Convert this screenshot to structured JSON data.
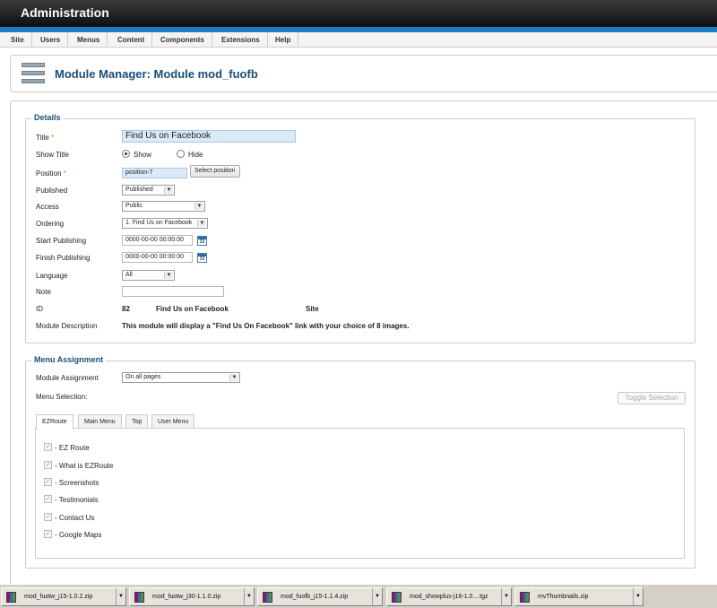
{
  "header": {
    "title": "Administration"
  },
  "menu": [
    "Site",
    "Users",
    "Menus",
    "Content",
    "Components",
    "Extensions",
    "Help"
  ],
  "page_title": "Module Manager: Module mod_fuofb",
  "details": {
    "legend": "Details",
    "title_label": "Title",
    "title_value": "Find Us on Facebook",
    "show_title_label": "Show Title",
    "show_option": "Show",
    "hide_option": "Hide",
    "position_label": "Position",
    "position_value": "position-7",
    "select_position_button": "Select position",
    "published_label": "Published",
    "published_value": "Published",
    "access_label": "Access",
    "access_value": "Public",
    "ordering_label": "Ordering",
    "ordering_value": "1. Find Us on Facebook",
    "start_publishing_label": "Start Publishing",
    "start_publishing_value": "0000-00-00 00:00:00",
    "finish_publishing_label": "Finish Publishing",
    "finish_publishing_value": "0000-00-00 00:00:00",
    "calendar_day": "33",
    "language_label": "Language",
    "language_value": "All",
    "note_label": "Note",
    "note_value": "",
    "id_label": "ID",
    "id_value": "82",
    "id_module_name": "Find Us on Facebook",
    "id_client": "Site",
    "description_label": "Module Description",
    "description_value": "This module will display a \"Find Us On Facebook\" link with your choice of 8 images."
  },
  "menu_assignment": {
    "legend": "Menu Assignment",
    "module_assignment_label": "Module Assignment",
    "module_assignment_value": "On all pages",
    "menu_selection_label": "Menu Selection:",
    "toggle_button": "Toggle Selection",
    "tabs": [
      "EZRoute",
      "Main Menu",
      "Top",
      "User Menu"
    ],
    "items": [
      "- EZ Route",
      "- What is EZRoute",
      "- Screenshots",
      "- Testimonials",
      "- Contact Us",
      "- Google Maps"
    ]
  },
  "downloads": [
    "mod_fuotw_j15-1.0.2.zip",
    "mod_fuotw_j30-1.1.0.zip",
    "mod_fuofb_j15-1.1.4.zip",
    "mod_showplus-j16-1.0....tgz",
    "mvThumbnails.zip"
  ],
  "colors": {
    "accent": "#1d7cc4",
    "title": "#1b4e77",
    "required": "#d77b00"
  }
}
